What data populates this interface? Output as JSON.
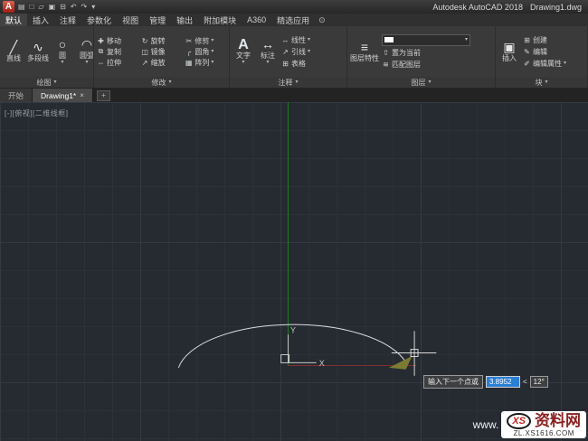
{
  "title_bar": {
    "logo_letter": "A",
    "qat": [
      "▤",
      "□",
      "▱",
      "▣",
      "⊟",
      "↶",
      "↷",
      "▾"
    ],
    "title": "Autodesk AutoCAD 2018",
    "doc": "Drawing1.dwg"
  },
  "ribbon": {
    "caret": "▾",
    "infocenter_glyph": "⊙",
    "tabs": [
      {
        "label": "默认"
      },
      {
        "label": "插入"
      },
      {
        "label": "注释"
      },
      {
        "label": "参数化"
      },
      {
        "label": "视图"
      },
      {
        "label": "管理"
      },
      {
        "label": "输出"
      },
      {
        "label": "附加模块"
      },
      {
        "label": "A360"
      },
      {
        "label": "精选应用"
      }
    ],
    "panels": {
      "draw": {
        "label": "绘图",
        "tools": [
          {
            "label": "直线",
            "glyph": "╱"
          },
          {
            "label": "多段线",
            "glyph": "∿"
          },
          {
            "label": "圆",
            "glyph": "○"
          },
          {
            "label": "圆弧",
            "glyph": "◠"
          }
        ]
      },
      "modify": {
        "label": "修改",
        "tools": [
          {
            "label": "移动",
            "glyph": "✚"
          },
          {
            "label": "旋转",
            "glyph": "↻"
          },
          {
            "label": "修剪",
            "glyph": "✂"
          },
          {
            "label": "复制",
            "glyph": "⧉"
          },
          {
            "label": "镜像",
            "glyph": "◫"
          },
          {
            "label": "圆角",
            "glyph": "╭"
          },
          {
            "label": "拉伸",
            "glyph": "⇔"
          },
          {
            "label": "缩放",
            "glyph": "↗"
          },
          {
            "label": "阵列",
            "glyph": "▦"
          }
        ]
      },
      "annotate": {
        "label": "注释",
        "big": [
          {
            "label": "文字",
            "glyph": "A"
          },
          {
            "label": "标注",
            "glyph": "↔"
          }
        ],
        "small": [
          {
            "label": "线性",
            "glyph": "↔"
          },
          {
            "label": "引线",
            "glyph": "↗"
          },
          {
            "label": "表格",
            "glyph": "⊞"
          }
        ]
      },
      "layers": {
        "label": "图层",
        "big": {
          "label": "图层特性",
          "glyph": "≡"
        },
        "small": [
          {
            "label": "置为当前",
            "glyph": "⇧"
          },
          {
            "label": "匹配图层",
            "glyph": "≋"
          }
        ]
      },
      "block": {
        "label": "块",
        "big": {
          "label": "插入",
          "glyph": "▣"
        },
        "small": [
          {
            "label": "创建",
            "glyph": "⊞"
          },
          {
            "label": "编辑",
            "glyph": "✎"
          },
          {
            "label": "编辑属性",
            "glyph": "✐"
          }
        ]
      }
    }
  },
  "file_tabs": {
    "start": "开始",
    "drawing": "Drawing1*",
    "close": "×",
    "new": "+"
  },
  "canvas": {
    "viewport_label": "[-][俯视][二维线框]",
    "ucs_x": "X",
    "ucs_y": "Y",
    "dynamic_input": {
      "prompt": "输入下一个点或",
      "value": "3.8952",
      "angle_prefix": "<",
      "angle": "12°"
    }
  },
  "watermark": {
    "www": "www.",
    "logo": "XS",
    "name": "资料网",
    "url": "ZL.XS1616.COM"
  },
  "colors": {
    "canvas_bg": "#262a31",
    "grid_line": "#2c313a",
    "axis_green": "#1f7a1f",
    "axis_red": "#803030",
    "selection_blue": "#2a7fd4",
    "arc_stroke": "#dcdcdc"
  }
}
